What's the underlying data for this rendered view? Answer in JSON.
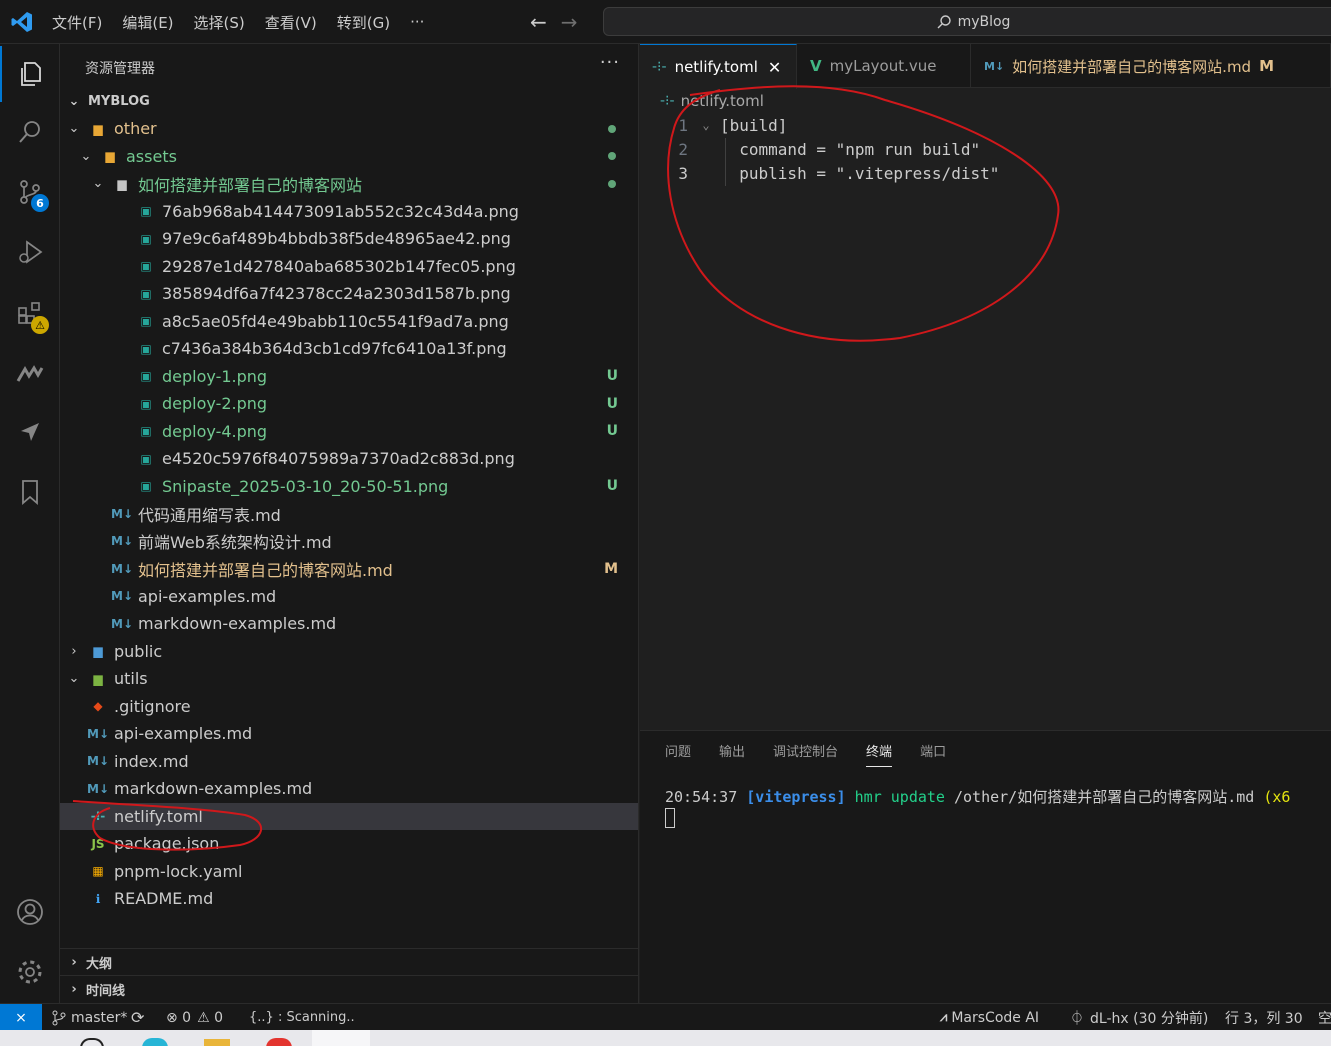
{
  "titlebar": {
    "menu": [
      "文件(F)",
      "编辑(E)",
      "选择(S)",
      "查看(V)",
      "转到(G)",
      "···"
    ],
    "search_text": "myBlog"
  },
  "activity": {
    "scm_badge": "6",
    "extensions_badge": "⚠"
  },
  "sidebar": {
    "header": "资源管理器",
    "more": "···",
    "root": "MYBLOG",
    "rows": [
      {
        "label": "other",
        "chev": "⌄",
        "indent": 1,
        "icon": "folder-icon",
        "color": "orange",
        "dot": true
      },
      {
        "label": "assets",
        "chev": "⌄",
        "indent": 2,
        "icon": "folder-icon",
        "color": "green",
        "dot": true
      },
      {
        "label": "如何搭建并部署自己的博客网站",
        "chev": "⌄",
        "indent": 3,
        "icon": "folder-open-icon",
        "color": "green",
        "dot": true
      },
      {
        "label": "76ab968ab414473091ab552c32c43d4a.png",
        "indent": 4,
        "icon": "image-icon",
        "color": "white"
      },
      {
        "label": "97e9c6af489b4bbdb38f5de48965ae42.png",
        "indent": 4,
        "icon": "image-icon",
        "color": "white"
      },
      {
        "label": "29287e1d427840aba685302b147fec05.png",
        "indent": 4,
        "icon": "image-icon",
        "color": "white"
      },
      {
        "label": "385894df6a7f42378cc24a2303d1587b.png",
        "indent": 4,
        "icon": "image-icon",
        "color": "white"
      },
      {
        "label": "a8c5ae05fd4e49babb110c5541f9ad7a.png",
        "indent": 4,
        "icon": "image-icon",
        "color": "white"
      },
      {
        "label": "c7436a384b364d3cb1cd97fc6410a13f.png",
        "indent": 4,
        "icon": "image-icon",
        "color": "white"
      },
      {
        "label": "deploy-1.png",
        "indent": 4,
        "icon": "image-icon",
        "color": "green",
        "status": "U"
      },
      {
        "label": "deploy-2.png",
        "indent": 4,
        "icon": "image-icon",
        "color": "green",
        "status": "U"
      },
      {
        "label": "deploy-4.png",
        "indent": 4,
        "icon": "image-icon",
        "color": "green",
        "status": "U"
      },
      {
        "label": "e4520c5976f84075989a7370ad2c883d.png",
        "indent": 4,
        "icon": "image-icon",
        "color": "white"
      },
      {
        "label": "Snipaste_2025-03-10_20-50-51.png",
        "indent": 4,
        "icon": "image-icon",
        "color": "green",
        "status": "U"
      },
      {
        "label": "代码通用缩写表.md",
        "indent": 3,
        "icon": "markdown-icon",
        "color": "white"
      },
      {
        "label": "前端Web系统架构设计.md",
        "indent": 3,
        "icon": "markdown-icon",
        "color": "white"
      },
      {
        "label": "如何搭建并部署自己的博客网站.md",
        "indent": 3,
        "icon": "markdown-icon",
        "color": "orange",
        "status": "M"
      },
      {
        "label": "api-examples.md",
        "indent": 3,
        "icon": "markdown-icon",
        "color": "white"
      },
      {
        "label": "markdown-examples.md",
        "indent": 3,
        "icon": "markdown-icon",
        "color": "white"
      },
      {
        "label": "public",
        "chev": "›",
        "indent": 1,
        "icon": "folder-public-icon",
        "color": "white"
      },
      {
        "label": "utils",
        "chev": "⌄",
        "indent": 1,
        "icon": "folder-utils-icon",
        "color": "white"
      },
      {
        "label": ".gitignore",
        "indent": 1,
        "icon": "git-icon",
        "color": "white"
      },
      {
        "label": "api-examples.md",
        "indent": 1,
        "icon": "markdown-icon",
        "color": "white"
      },
      {
        "label": "index.md",
        "indent": 1,
        "icon": "markdown-icon",
        "color": "white"
      },
      {
        "label": "markdown-examples.md",
        "indent": 1,
        "icon": "markdown-icon",
        "color": "white"
      },
      {
        "label": "netlify.toml",
        "indent": 1,
        "icon": "netlify-icon",
        "color": "white",
        "selected": true
      },
      {
        "label": "package.json",
        "indent": 1,
        "icon": "json-icon",
        "color": "white"
      },
      {
        "label": "pnpm-lock.yaml",
        "indent": 1,
        "icon": "pnpm-icon",
        "color": "white"
      },
      {
        "label": "README.md",
        "indent": 1,
        "icon": "info-icon",
        "color": "white"
      }
    ],
    "outline": "大纲",
    "timeline": "时间线"
  },
  "editor": {
    "tabs": [
      {
        "label": "netlify.toml",
        "close": "✕",
        "active": true
      },
      {
        "label": "myLayout.vue"
      },
      {
        "label": "如何搭建并部署自己的博客网站.md",
        "status": "M"
      }
    ],
    "breadcrumb": "netlify.toml",
    "lines": [
      {
        "num": "1",
        "fold": "⌄",
        "text": "[build]"
      },
      {
        "num": "2",
        "text": "  command = \"npm run build\""
      },
      {
        "num": "3",
        "text": "  publish = \".vitepress/dist\""
      }
    ]
  },
  "panel": {
    "tabs": [
      "问题",
      "输出",
      "调试控制台",
      "终端",
      "端口"
    ],
    "active_tab": "终端",
    "term": {
      "time": "20:54:37",
      "tag": "[vitepress]",
      "action": "hmr update",
      "path": "/other/如何搭建并部署自己的博客网站.md",
      "suffix": "(x6"
    }
  },
  "statusbar": {
    "remote": "⨯",
    "branch": "master*",
    "sync": "⟳",
    "errors": "⊗ 0",
    "warnings": "⚠ 0",
    "scanning": "{..} : Scanning..",
    "marscode": "MarsCode AI",
    "author": "dL-hx (30 分钟前)",
    "position": "行 3，列 30",
    "trailing": "空"
  },
  "colors": {
    "accent": "#0078d4",
    "untracked": "#73c991",
    "modified": "#e2c08d",
    "annotation": "#d0181b"
  }
}
